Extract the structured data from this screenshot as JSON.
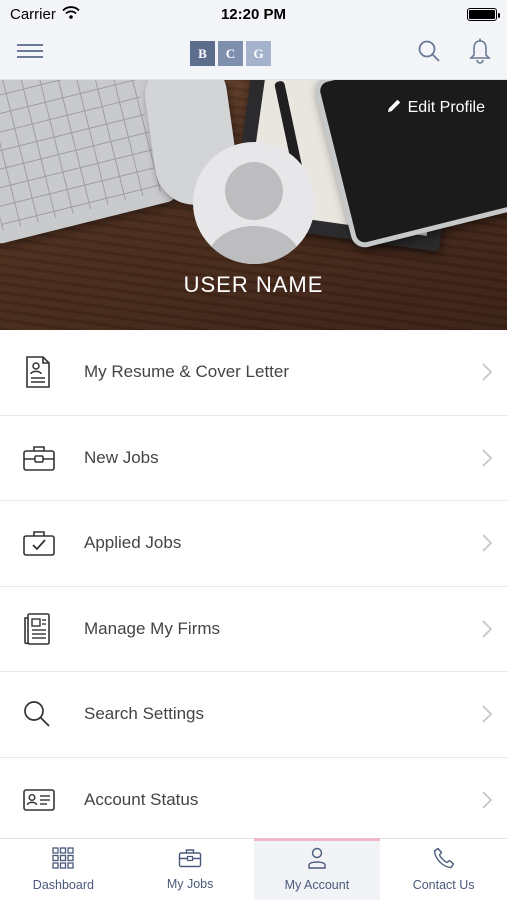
{
  "status_bar": {
    "carrier": "Carrier",
    "time": "12:20 PM",
    "battery_level": 1.0
  },
  "nav": {
    "logo_letters": [
      "B",
      "C",
      "G"
    ],
    "logo_colors": [
      "#5d6d8e",
      "#7f8fae",
      "#a4b2cc"
    ],
    "menu_icon": "hamburger-icon",
    "search_icon": "search-icon",
    "notifications_icon": "bell-icon"
  },
  "profile": {
    "edit_label": "Edit Profile",
    "user_name": "USER NAME",
    "avatar_icon": "default-avatar-icon"
  },
  "menu": {
    "items": [
      {
        "label": "My Resume & Cover Letter",
        "icon": "resume-icon"
      },
      {
        "label": "New Jobs",
        "icon": "briefcase-icon"
      },
      {
        "label": "Applied Jobs",
        "icon": "briefcase-check-icon"
      },
      {
        "label": "Manage My Firms",
        "icon": "newspaper-icon"
      },
      {
        "label": "Search Settings",
        "icon": "search-icon"
      },
      {
        "label": "Account Status",
        "icon": "id-card-icon"
      }
    ]
  },
  "tabs": {
    "items": [
      {
        "label": "Dashboard",
        "icon": "grid-icon",
        "active": false
      },
      {
        "label": "My Jobs",
        "icon": "briefcase-icon",
        "active": false
      },
      {
        "label": "My Account",
        "icon": "person-icon",
        "active": true
      },
      {
        "label": "Contact Us",
        "icon": "phone-icon",
        "active": false
      }
    ]
  },
  "colors": {
    "accent": "#4a5a7a",
    "active_tab_indicator": "#f0b8c4",
    "chrome_background": "#f4f5f8"
  }
}
